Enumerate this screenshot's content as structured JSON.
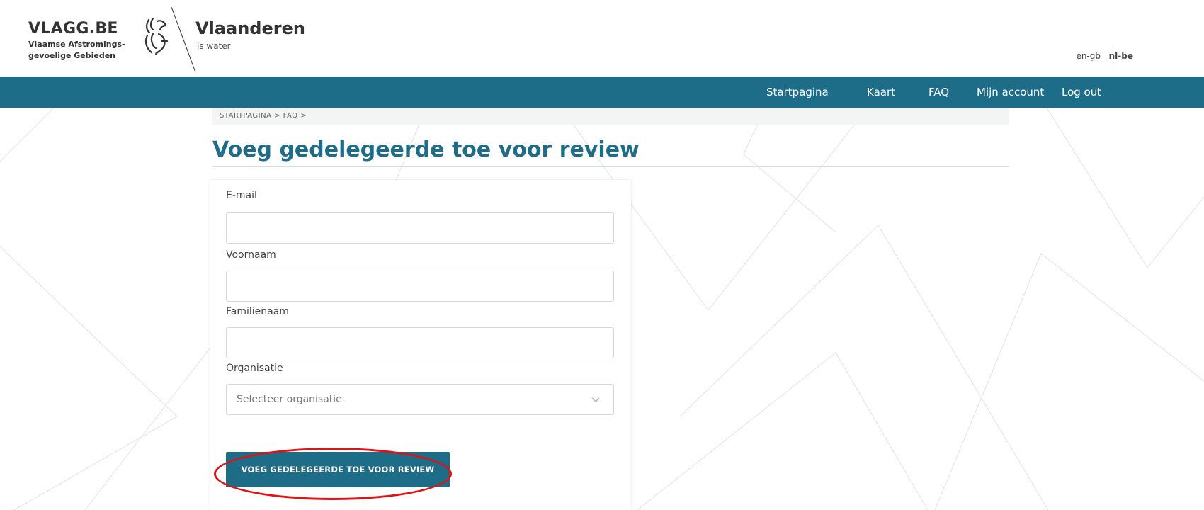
{
  "header": {
    "brand_title": "VLAGG.BE",
    "brand_sub_1": "Vlaamse Afstromings-",
    "brand_sub_2": "gevoelige Gebieden",
    "gov_name": "Vlaanderen",
    "gov_tag": "is water",
    "languages": [
      "en-gb",
      "nl-be"
    ]
  },
  "nav": {
    "items": [
      "Startpagina",
      "Kaart",
      "FAQ",
      "Mijn account",
      "Log out"
    ]
  },
  "breadcrumb": "STARTPAGINA  >  FAQ  >",
  "page": {
    "title": "Voeg gedelegeerde toe voor review"
  },
  "form": {
    "email_label": "E-mail",
    "email_value": "",
    "firstname_label": "Voornaam",
    "firstname_value": "",
    "lastname_label": "Familienaam",
    "lastname_value": "",
    "org_label": "Organisatie",
    "org_selected": "Selecteer organisatie",
    "submit_label": "VOEG GEDELEGEERDE TOE VOOR REVIEW"
  },
  "colors": {
    "primary": "#1d6c88",
    "highlight": "#e31111"
  },
  "icons": [
    "vlaanderen-lion-icon",
    "chevron-down-icon"
  ]
}
